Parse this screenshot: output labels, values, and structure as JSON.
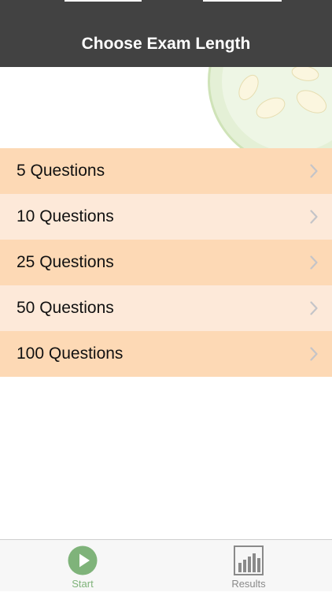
{
  "nav": {
    "title": "Choose Exam Length",
    "background": "#424242",
    "title_color": "#ffffff"
  },
  "header_art": {
    "icon": "cucumber-slice-icon"
  },
  "exam_options": [
    {
      "label": "5 Questions",
      "background": "#fdd9b5"
    },
    {
      "label": "10 Questions",
      "background": "#fde9d9"
    },
    {
      "label": "25 Questions",
      "background": "#fdd9b5"
    },
    {
      "label": "50 Questions",
      "background": "#fde9d9"
    },
    {
      "label": "100 Questions",
      "background": "#fdd9b5"
    }
  ],
  "tab_bar": {
    "tabs": [
      {
        "label": "Start",
        "icon": "play-icon",
        "selected": true,
        "color": "#7fb37a"
      },
      {
        "label": "Results",
        "icon": "bar-chart-icon",
        "selected": false,
        "color": "#8a8a8a"
      }
    ]
  }
}
